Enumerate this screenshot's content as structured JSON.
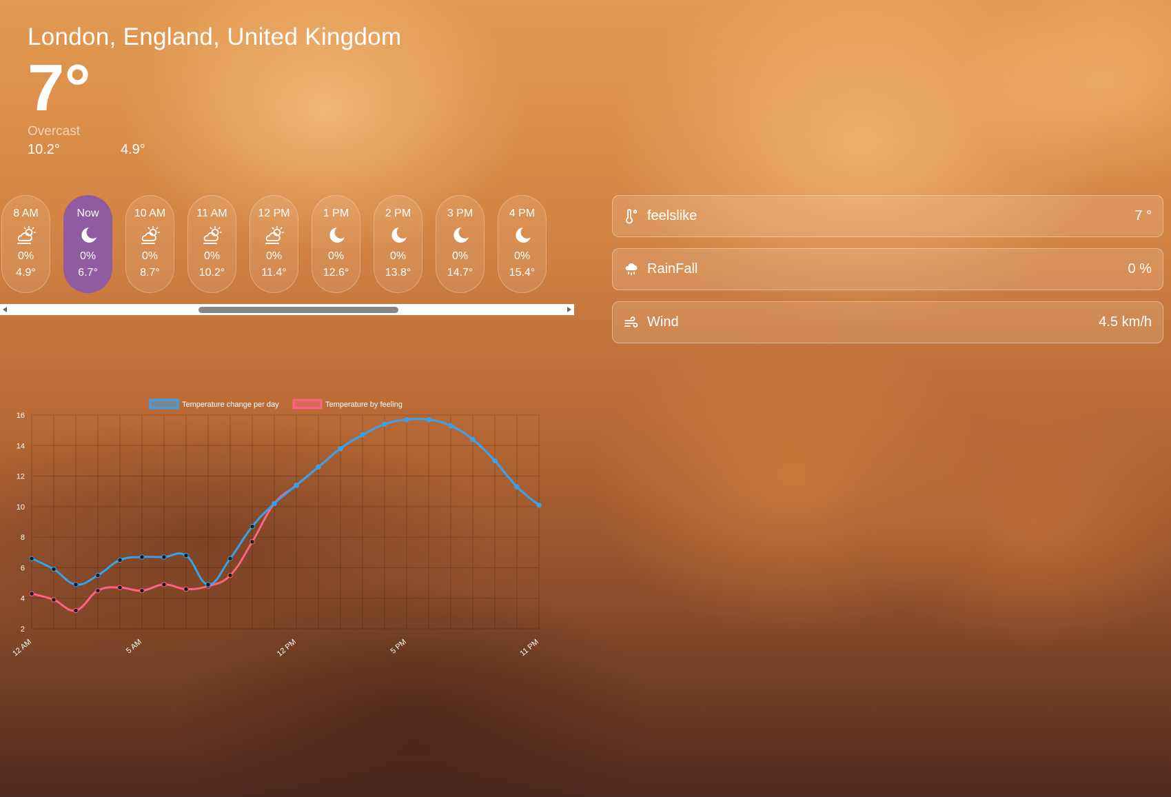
{
  "location": {
    "name": "London, England, United Kingdom"
  },
  "current": {
    "temp": "7°",
    "condition": "Overcast",
    "high": "10.2°",
    "low": "4.9°"
  },
  "hourly": [
    {
      "time": "8 AM",
      "icon": "partly-cloudy-sun-icon",
      "precip": "0%",
      "temp": "4.9°"
    },
    {
      "time": "Now",
      "icon": "moon-icon",
      "precip": "0%",
      "temp": "6.7°"
    },
    {
      "time": "10 AM",
      "icon": "partly-cloudy-sun-icon",
      "precip": "0%",
      "temp": "8.7°"
    },
    {
      "time": "11 AM",
      "icon": "partly-cloudy-sun-icon",
      "precip": "0%",
      "temp": "10.2°"
    },
    {
      "time": "12 PM",
      "icon": "partly-cloudy-sun-icon",
      "precip": "0%",
      "temp": "11.4°"
    },
    {
      "time": "1 PM",
      "icon": "moon-icon",
      "precip": "0%",
      "temp": "12.6°"
    },
    {
      "time": "2 PM",
      "icon": "moon-icon",
      "precip": "0%",
      "temp": "13.8°"
    },
    {
      "time": "3 PM",
      "icon": "moon-icon",
      "precip": "0%",
      "temp": "14.7°"
    },
    {
      "time": "4 PM",
      "icon": "moon-icon",
      "precip": "0%",
      "temp": "15.4°"
    }
  ],
  "details": [
    {
      "icon": "thermometer-icon",
      "label": "feelslike",
      "value": "7 °"
    },
    {
      "icon": "rain-cloud-icon",
      "label": "RainFall",
      "value": "0 %"
    },
    {
      "icon": "wind-icon",
      "label": "Wind",
      "value": "4.5 km/h"
    }
  ],
  "colors": {
    "active_hour": "#8f5c9f",
    "series_temp": "#36a2eb",
    "series_feel": "#ff6384"
  },
  "chart_data": {
    "type": "line",
    "title": "",
    "xlabel": "",
    "ylabel": "",
    "x": [
      "12 AM",
      "1 AM",
      "2 AM",
      "3 AM",
      "4 AM",
      "5 AM",
      "6 AM",
      "7 AM",
      "8 AM",
      "9 AM",
      "10 AM",
      "11 AM",
      "12 PM",
      "1 PM",
      "2 PM",
      "3 PM",
      "4 PM",
      "5 PM",
      "6 PM",
      "7 PM",
      "8 PM",
      "9 PM",
      "10 PM",
      "11 PM"
    ],
    "x_tick_labels": [
      "12 AM",
      "5 AM",
      "12 PM",
      "5 PM",
      "11 PM"
    ],
    "ylim": [
      2,
      16
    ],
    "y_ticks": [
      2,
      4,
      6,
      8,
      10,
      12,
      14,
      16
    ],
    "grid": true,
    "legend_position": "top",
    "series": [
      {
        "name": "Temperature change per day",
        "color": "#36a2eb",
        "values": [
          6.6,
          5.9,
          4.9,
          5.5,
          6.5,
          6.7,
          6.7,
          6.8,
          4.9,
          6.6,
          8.7,
          10.2,
          11.4,
          12.6,
          13.8,
          14.7,
          15.4,
          15.7,
          15.7,
          15.3,
          14.4,
          13.0,
          11.3,
          10.1
        ]
      },
      {
        "name": "Temperature by feeling",
        "color": "#ff6384",
        "values": [
          4.3,
          3.9,
          3.2,
          4.5,
          4.7,
          4.5,
          4.9,
          4.6,
          4.8,
          5.5,
          7.7,
          10.2,
          11.4,
          12.6,
          13.8,
          14.7,
          15.4,
          15.7,
          15.7,
          15.3,
          14.4,
          13.0,
          11.3,
          10.1
        ]
      }
    ]
  }
}
